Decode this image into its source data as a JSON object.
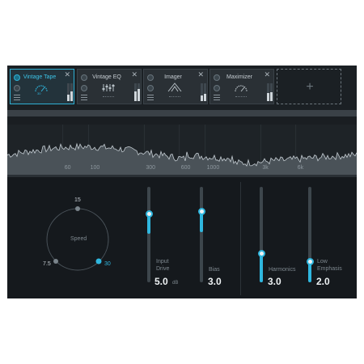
{
  "modules": [
    {
      "name": "Vintage Tape",
      "active": true,
      "gauge_label": "30",
      "meter": [
        0.35,
        0.55
      ]
    },
    {
      "name": "Vintage EQ",
      "active": false,
      "meter": [
        0.55,
        0.7
      ]
    },
    {
      "name": "Imager",
      "active": false,
      "meter": [
        0.3,
        0.4
      ]
    },
    {
      "name": "Maximizer",
      "active": false,
      "meter": [
        0.45,
        0.5
      ]
    }
  ],
  "add_module_label": "+",
  "close_glyph": "✕",
  "spectrum": {
    "freq_labels": [
      "60",
      "100",
      "300",
      "600",
      "1000",
      "3k",
      "6k"
    ],
    "freq_values": [
      60,
      100,
      300,
      600,
      1000,
      3000,
      6000
    ]
  },
  "speed_dial": {
    "label": "Speed",
    "options": [
      "7.5",
      "15",
      "30"
    ],
    "selected": "30"
  },
  "sliders": [
    {
      "name_lines": [
        "Input",
        "Drive"
      ],
      "value": "5.0",
      "unit": "dB",
      "level": 0.72
    },
    {
      "name_lines": [
        "Bias"
      ],
      "value": "3.0",
      "unit": "",
      "level": 0.74
    },
    {
      "name_lines": [
        "Harmonics"
      ],
      "value": "3.0",
      "unit": "",
      "level": 0.3
    },
    {
      "name_lines": [
        "Low",
        "Emphasis"
      ],
      "value": "2.0",
      "unit": "",
      "level": 0.22
    }
  ],
  "colors": {
    "accent": "#2fb7df",
    "panel": "#15191d",
    "module": "#2a3035"
  }
}
